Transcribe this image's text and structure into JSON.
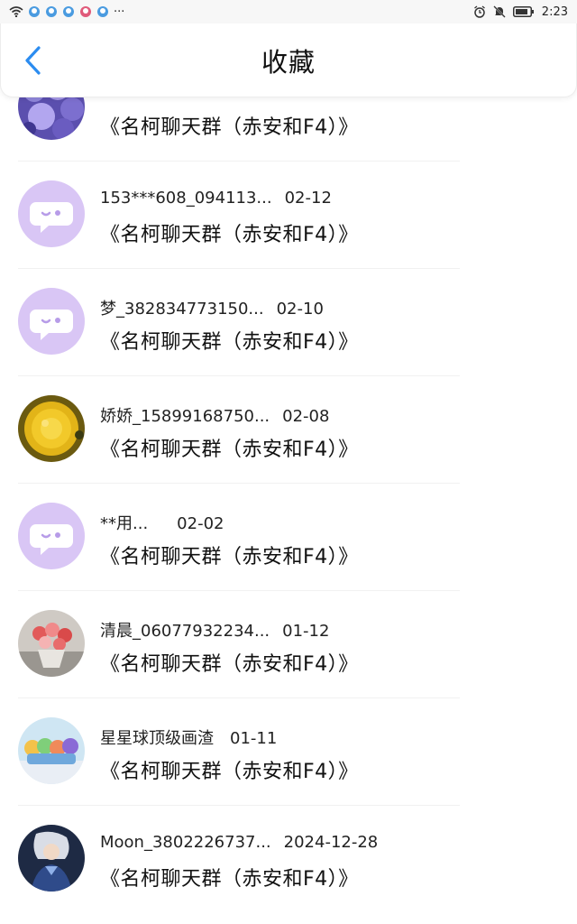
{
  "status_bar": {
    "time": "2:23",
    "dots": "···"
  },
  "header": {
    "title": "收藏",
    "back_icon": "chevron-left-icon",
    "accent_color": "#2b8cf0"
  },
  "items": [
    {
      "name": "",
      "date": "",
      "content": "《名柯聊天群（赤安和F4）》",
      "avatar": "purple-flowers-photo"
    },
    {
      "name": "153***608_094113...",
      "date": "02-12",
      "content": "《名柯聊天群（赤安和F4）》",
      "avatar": "default-chat-bubble"
    },
    {
      "name": "梦_382834773150...",
      "date": "02-10",
      "content": "《名柯聊天群（赤安和F4）》",
      "avatar": "default-chat-bubble"
    },
    {
      "name": "娇娇_15899168750...",
      "date": "02-08",
      "content": "《名柯聊天群（赤安和F4）》",
      "avatar": "yellow-flower-photo"
    },
    {
      "name": "**用...",
      "date": "02-02",
      "content": "《名柯聊天群（赤安和F4）》",
      "avatar": "default-chat-bubble"
    },
    {
      "name": "清晨_06077932234...",
      "date": "01-12",
      "content": "《名柯聊天群（赤安和F4）》",
      "avatar": "rose-bouquet-photo"
    },
    {
      "name": "星星球顶级画渣",
      "date": "01-11",
      "content": "《名柯聊天群（赤安和F4）》",
      "avatar": "cartoon-group-photo"
    },
    {
      "name": "Moon_3802226737...",
      "date": "2024-12-28",
      "content": "《名柯聊天群（赤安和F4）》",
      "avatar": "anime-character-photo"
    }
  ]
}
